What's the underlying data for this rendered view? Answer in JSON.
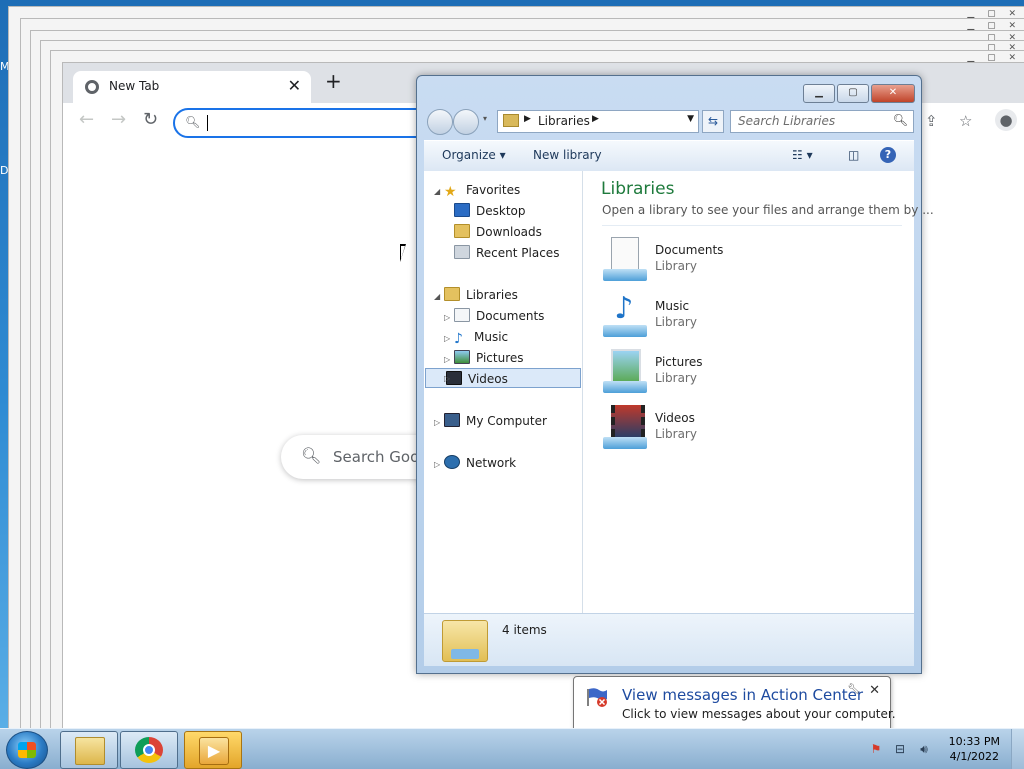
{
  "desktop": {
    "edge_letters": [
      "M",
      "D"
    ]
  },
  "browser": {
    "tab_title": "New Tab",
    "tab_close": "✕",
    "new_tab": "+",
    "google_search_placeholder": "Search Goo"
  },
  "explorer": {
    "window_controls": {
      "minimize": "▁",
      "maximize": "▢",
      "close": "✕"
    },
    "breadcrumb": "Libraries",
    "search_placeholder": "Search Libraries",
    "commands": {
      "organize": "Organize ▾",
      "new_library": "New library"
    },
    "help_label": "?",
    "nav": {
      "favorites": {
        "label": "Favorites",
        "items": [
          "Desktop",
          "Downloads",
          "Recent Places"
        ]
      },
      "libraries": {
        "label": "Libraries",
        "items": [
          "Documents",
          "Music",
          "Pictures",
          "Videos"
        ],
        "selected": "Videos"
      },
      "my_computer": "My Computer",
      "network": "Network"
    },
    "content": {
      "title": "Libraries",
      "subtitle": "Open a library to see your files and arrange them by ...",
      "items": [
        {
          "name": "Documents",
          "type": "Library"
        },
        {
          "name": "Music",
          "type": "Library"
        },
        {
          "name": "Pictures",
          "type": "Library"
        },
        {
          "name": "Videos",
          "type": "Library"
        }
      ]
    },
    "status": {
      "count": "4 items"
    }
  },
  "notification": {
    "title": "View messages in Action Center",
    "body": "Click to view messages about your computer.",
    "close": "✕"
  },
  "taskbar": {
    "time": "10:33 PM",
    "date": "4/1/2022"
  },
  "colors": {
    "libraries_title": "#1e7a3c",
    "accent_blue": "#1a73e8",
    "notification_title": "#1e4ba0"
  }
}
